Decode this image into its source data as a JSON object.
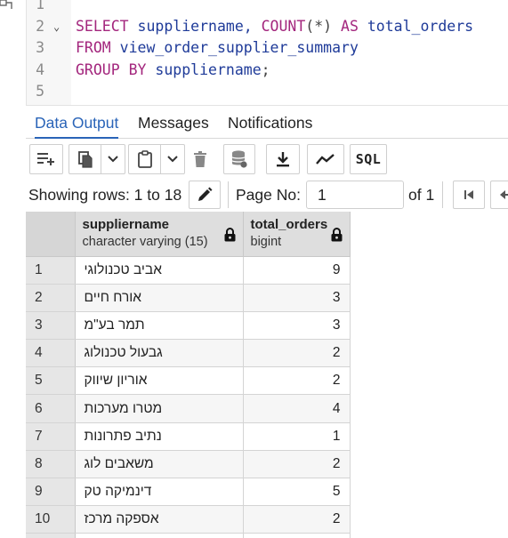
{
  "editor": {
    "lines": [
      {
        "num": "1",
        "fold": "",
        "tokens": []
      },
      {
        "num": "2",
        "fold": "⌄",
        "tokens": [
          {
            "t": "SELECT",
            "c": "kw"
          },
          {
            "t": " suppliername, ",
            "c": ""
          },
          {
            "t": "COUNT",
            "c": "kw"
          },
          {
            "t": "(",
            "c": "op"
          },
          {
            "t": "*",
            "c": "op"
          },
          {
            "t": ")",
            "c": "op"
          },
          {
            "t": " ",
            "c": ""
          },
          {
            "t": "AS",
            "c": "kw"
          },
          {
            "t": " total_orders",
            "c": ""
          }
        ]
      },
      {
        "num": "3",
        "fold": "",
        "tokens": [
          {
            "t": "FROM",
            "c": "kw"
          },
          {
            "t": " view_order_supplier_summary",
            "c": ""
          }
        ]
      },
      {
        "num": "4",
        "fold": "",
        "tokens": [
          {
            "t": "GROUP BY",
            "c": "kw"
          },
          {
            "t": " suppliername",
            "c": ""
          },
          {
            "t": ";",
            "c": "op"
          }
        ]
      },
      {
        "num": "5",
        "fold": "",
        "tokens": []
      }
    ]
  },
  "tabs": [
    {
      "label": "Data Output",
      "active": true
    },
    {
      "label": "Messages",
      "active": false
    },
    {
      "label": "Notifications",
      "active": false
    }
  ],
  "toolbar": {
    "sql_label": "SQL",
    "icons": [
      "add-row-icon",
      "copy-icon",
      "dropdown-icon",
      "paste-icon",
      "dropdown-icon",
      "delete-icon",
      "save-data-icon",
      "download-icon",
      "graph-icon",
      "sql-icon"
    ]
  },
  "rows_bar": {
    "showing_label": "Showing rows: 1 to 18",
    "page_label": "Page No:",
    "page_value": "1",
    "of_label": "of 1"
  },
  "grid": {
    "columns": [
      {
        "name": "suppliername",
        "type": "character varying (15)"
      },
      {
        "name": "total_orders",
        "type": "bigint"
      }
    ],
    "rows": [
      {
        "n": "1",
        "name": "אביב טכנולוגי",
        "total": "9"
      },
      {
        "n": "2",
        "name": "אורח חיים",
        "total": "3"
      },
      {
        "n": "3",
        "name": "תמר בע\"מ",
        "total": "3"
      },
      {
        "n": "4",
        "name": "גבעול טכנולוג",
        "total": "2"
      },
      {
        "n": "5",
        "name": "אוריון שיווק",
        "total": "2"
      },
      {
        "n": "6",
        "name": "מטרו מערכות",
        "total": "4"
      },
      {
        "n": "7",
        "name": "נתיב פתרונות",
        "total": "1"
      },
      {
        "n": "8",
        "name": "משאבים לוג",
        "total": "2"
      },
      {
        "n": "9",
        "name": "דינמיקה טק",
        "total": "5"
      },
      {
        "n": "10",
        "name": "אספקה מרכז",
        "total": "2"
      }
    ]
  },
  "colors": {
    "keyword": "#a3267d",
    "identifier": "#1f3b99",
    "active_tab": "#2a64b8"
  }
}
